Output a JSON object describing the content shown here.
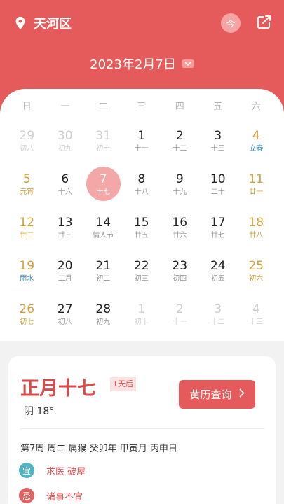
{
  "header": {
    "location": "天河区",
    "today_label": "今",
    "month_title": "2023年2月7日",
    "colors": {
      "header_bg": "#e55a5a",
      "accent": "#e55a5a"
    },
    "icons": {
      "location": "location-pin-icon",
      "share": "share-icon",
      "dropdown": "chevron-down-icon"
    }
  },
  "calendar": {
    "weekdays": [
      "日",
      "一",
      "二",
      "三",
      "四",
      "五",
      "六"
    ],
    "weeks": [
      [
        {
          "day": "29",
          "lunar": "初八",
          "type": "other"
        },
        {
          "day": "30",
          "lunar": "初九",
          "type": "other"
        },
        {
          "day": "31",
          "lunar": "初十",
          "type": "other"
        },
        {
          "day": "1",
          "lunar": "十一",
          "type": "normal"
        },
        {
          "day": "2",
          "lunar": "十二",
          "type": "normal"
        },
        {
          "day": "3",
          "lunar": "十三",
          "type": "normal"
        },
        {
          "day": "4",
          "lunar": "立春",
          "type": "wkend-term"
        }
      ],
      [
        {
          "day": "5",
          "lunar": "元宵",
          "type": "wkend-fest"
        },
        {
          "day": "6",
          "lunar": "十六",
          "type": "normal"
        },
        {
          "day": "7",
          "lunar": "十七",
          "type": "selected"
        },
        {
          "day": "8",
          "lunar": "十八",
          "type": "normal"
        },
        {
          "day": "9",
          "lunar": "十九",
          "type": "normal"
        },
        {
          "day": "10",
          "lunar": "二十",
          "type": "normal"
        },
        {
          "day": "11",
          "lunar": "廿一",
          "type": "wkend"
        }
      ],
      [
        {
          "day": "12",
          "lunar": "廿二",
          "type": "wkend"
        },
        {
          "day": "13",
          "lunar": "廿三",
          "type": "normal"
        },
        {
          "day": "14",
          "lunar": "情人节",
          "type": "normal"
        },
        {
          "day": "15",
          "lunar": "廿五",
          "type": "normal"
        },
        {
          "day": "16",
          "lunar": "廿六",
          "type": "normal"
        },
        {
          "day": "17",
          "lunar": "廿七",
          "type": "normal"
        },
        {
          "day": "18",
          "lunar": "廿八",
          "type": "wkend"
        }
      ],
      [
        {
          "day": "19",
          "lunar": "雨水",
          "type": "wkend-term"
        },
        {
          "day": "20",
          "lunar": "二月",
          "type": "normal"
        },
        {
          "day": "21",
          "lunar": "初二",
          "type": "normal"
        },
        {
          "day": "22",
          "lunar": "初三",
          "type": "normal"
        },
        {
          "day": "23",
          "lunar": "初四",
          "type": "normal"
        },
        {
          "day": "24",
          "lunar": "初五",
          "type": "normal"
        },
        {
          "day": "25",
          "lunar": "初六",
          "type": "wkend"
        }
      ],
      [
        {
          "day": "26",
          "lunar": "初七",
          "type": "wkend"
        },
        {
          "day": "27",
          "lunar": "初八",
          "type": "normal"
        },
        {
          "day": "28",
          "lunar": "初九",
          "type": "normal"
        },
        {
          "day": "1",
          "lunar": "初十",
          "type": "other"
        },
        {
          "day": "2",
          "lunar": "十一",
          "type": "other"
        },
        {
          "day": "3",
          "lunar": "十二",
          "type": "other"
        },
        {
          "day": "4",
          "lunar": "十三",
          "type": "other"
        }
      ]
    ]
  },
  "detail": {
    "lunar_date": "正月十七",
    "days_badge": "1天后",
    "weather": "阴 18°",
    "almanac_button": "黄历查询",
    "ganzhi": "第7周 周二 属猴 癸卯年 甲寅月 丙申日",
    "yi_label": "宜",
    "yi_text": "求医 破屋",
    "ji_label": "忌",
    "ji_text": "诸事不宜"
  }
}
